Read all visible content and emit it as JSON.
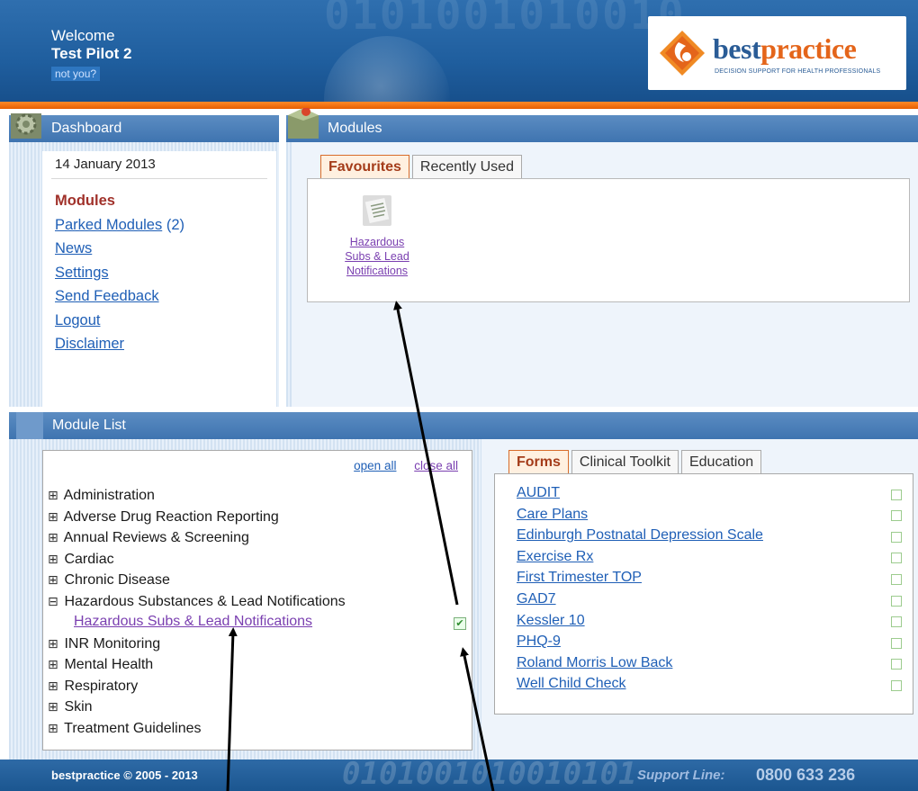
{
  "header": {
    "welcome": "Welcome",
    "user_name": "Test Pilot 2",
    "not_you": "not you?",
    "binary_watermark": "0101001010010",
    "logo": {
      "name_part1": "best",
      "name_part2": "practice",
      "tagline": "DECISION SUPPORT FOR HEALTH PROFESSIONALS",
      "brand_color": "#e4651a",
      "text_color": "#2a5c96"
    }
  },
  "dashboard": {
    "title": "Dashboard",
    "date": "14 January 2013",
    "links": {
      "modules": "Modules",
      "parked_modules": "Parked Modules",
      "parked_count": " (2)",
      "news": "News",
      "settings": "Settings",
      "send_feedback": "Send Feedback",
      "logout": "Logout",
      "disclaimer": "Disclaimer"
    }
  },
  "modules": {
    "title": "Modules",
    "tabs": [
      "Favourites",
      "Recently Used"
    ],
    "favourite": {
      "line1": "Hazardous",
      "line2": "Subs & Lead",
      "line3": "Notifications"
    }
  },
  "module_list": {
    "title": "Module List",
    "open_all": "open all",
    "close_all": "close all",
    "categories": [
      {
        "toggle": "⊞",
        "label": "Administration"
      },
      {
        "toggle": "⊞",
        "label": "Adverse Drug Reaction Reporting"
      },
      {
        "toggle": "⊞",
        "label": "Annual Reviews & Screening"
      },
      {
        "toggle": "⊞",
        "label": "Cardiac"
      },
      {
        "toggle": "⊞",
        "label": "Chronic Disease"
      },
      {
        "toggle": "⊟",
        "label": "Hazardous Substances & Lead Notifications"
      },
      {
        "toggle": "",
        "label": ""
      },
      {
        "toggle": "⊞",
        "label": "INR Monitoring"
      },
      {
        "toggle": "⊞",
        "label": "Mental Health"
      },
      {
        "toggle": "⊞",
        "label": "Respiratory"
      },
      {
        "toggle": "⊞",
        "label": "Skin"
      },
      {
        "toggle": "⊞",
        "label": "Treatment Guidelines"
      }
    ],
    "expanded_child": "Hazardous Subs & Lead Notifications",
    "child_checked": "✔"
  },
  "forms_panel": {
    "tabs": [
      "Forms",
      "Clinical Toolkit",
      "Education"
    ],
    "items": [
      "AUDIT",
      "Care Plans",
      "Edinburgh Postnatal Depression Scale",
      "Exercise Rx",
      "First Trimester TOP",
      "GAD7",
      "Kessler 10",
      "PHQ-9",
      "Roland Morris Low Back",
      "Well Child Check"
    ]
  },
  "footer": {
    "copyright": "bestpractice © 2005 - 2013",
    "binary_watermark": "0101001010010101",
    "support_label": "Support Line:",
    "phone": "0800 633 236"
  }
}
